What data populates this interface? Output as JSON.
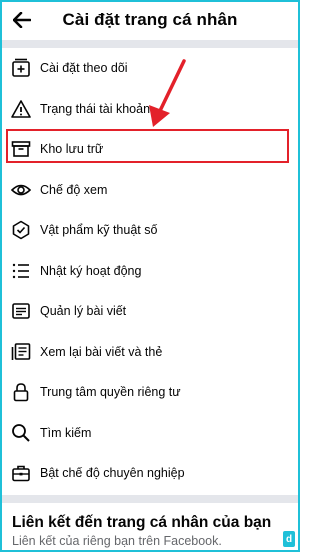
{
  "header": {
    "title": "Cài đặt trang cá nhân",
    "back_icon": "arrow-left-icon"
  },
  "menu": {
    "items": [
      {
        "label": "Cài đặt theo dõi",
        "icon": "feed-follow-icon"
      },
      {
        "label": "Trạng thái tài khoản",
        "icon": "warning-icon"
      },
      {
        "label": "Kho lưu trữ",
        "icon": "archive-icon"
      },
      {
        "label": "Chế độ xem",
        "icon": "eye-icon"
      },
      {
        "label": "Vật phẩm kỹ thuật số",
        "icon": "badge-check-icon"
      },
      {
        "label": "Nhật ký hoạt động",
        "icon": "list-icon"
      },
      {
        "label": "Quản lý bài viết",
        "icon": "document-icon"
      },
      {
        "label": "Xem lại bài viết và thẻ",
        "icon": "review-posts-icon"
      },
      {
        "label": "Trung tâm quyền riêng tư",
        "icon": "lock-icon"
      },
      {
        "label": "Tìm kiếm",
        "icon": "search-icon"
      },
      {
        "label": "Bật chế độ chuyên nghiệp",
        "icon": "briefcase-icon"
      }
    ]
  },
  "footer": {
    "title": "Liên kết đến trang cá nhân của bạn",
    "subtitle": "Liên kết của riêng bạn trên Facebook."
  },
  "annotations": {
    "highlight_color": "#e3212a",
    "frame_color": "#1fc0d8",
    "logo_text": "d"
  }
}
